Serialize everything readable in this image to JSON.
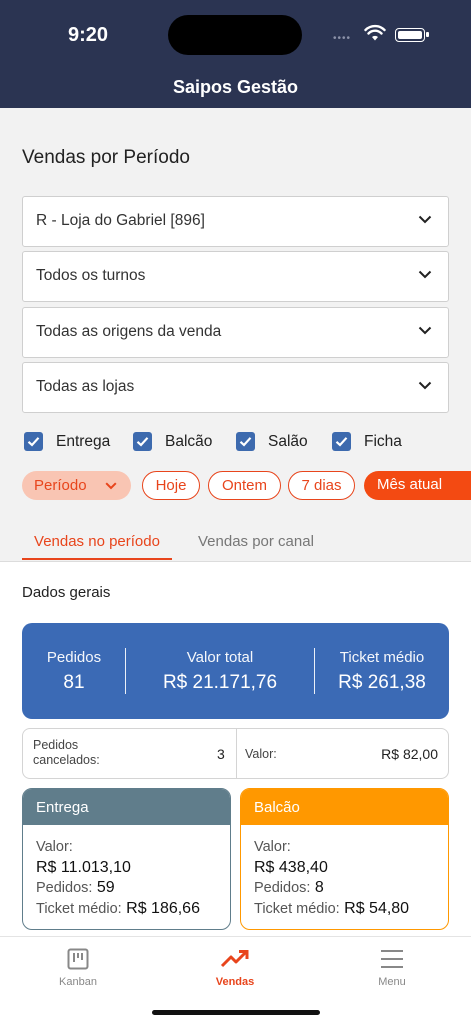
{
  "status_bar": {
    "time": "9:20",
    "signal": "••••"
  },
  "header": {
    "title": "Saipos Gestão"
  },
  "page": {
    "title": "Vendas por Período"
  },
  "filters": [
    {
      "value": "R - Loja do Gabriel [896]"
    },
    {
      "value": "Todos os turnos"
    },
    {
      "value": "Todas as origens da venda"
    },
    {
      "value": "Todas as lojas"
    }
  ],
  "checkboxes": [
    {
      "label": "Entrega",
      "checked": true
    },
    {
      "label": "Balcão",
      "checked": true
    },
    {
      "label": "Salão",
      "checked": true
    },
    {
      "label": "Ficha",
      "checked": true
    }
  ],
  "period_chips": {
    "periodo": "Período",
    "hoje": "Hoje",
    "ontem": "Ontem",
    "sete_dias": "7 dias",
    "mes_atual": "Mês atual"
  },
  "tabs": {
    "active": "Vendas no período",
    "inactive": "Vendas por canal"
  },
  "section": {
    "title": "Dados gerais"
  },
  "summary": {
    "pedidos_label": "Pedidos",
    "pedidos_value": "81",
    "valor_total_label": "Valor total",
    "valor_total_value": "R$ 21.171,76",
    "ticket_label": "Ticket médio",
    "ticket_value": "R$ 261,38"
  },
  "cancelled": {
    "label": "Pedidos cancelados:",
    "count": "3",
    "valor_label": "Valor:",
    "valor": "R$ 82,00"
  },
  "channels": [
    {
      "name": "Entrega",
      "color": "#607d8b",
      "valor_label": "Valor:",
      "valor": "R$ 11.013,10",
      "pedidos_label": "Pedidos:",
      "pedidos": "59",
      "ticket_label": "Ticket médio:",
      "ticket": "R$ 186,66"
    },
    {
      "name": "Balcão",
      "color": "#ff9800",
      "valor_label": "Valor:",
      "valor": "R$ 438,40",
      "pedidos_label": "Pedidos:",
      "pedidos": "8",
      "ticket_label": "Ticket médio:",
      "ticket": "R$ 54,80"
    }
  ],
  "bottom_nav": {
    "kanban": "Kanban",
    "vendas": "Vendas",
    "menu": "Menu",
    "active_color": "#e8451c"
  }
}
